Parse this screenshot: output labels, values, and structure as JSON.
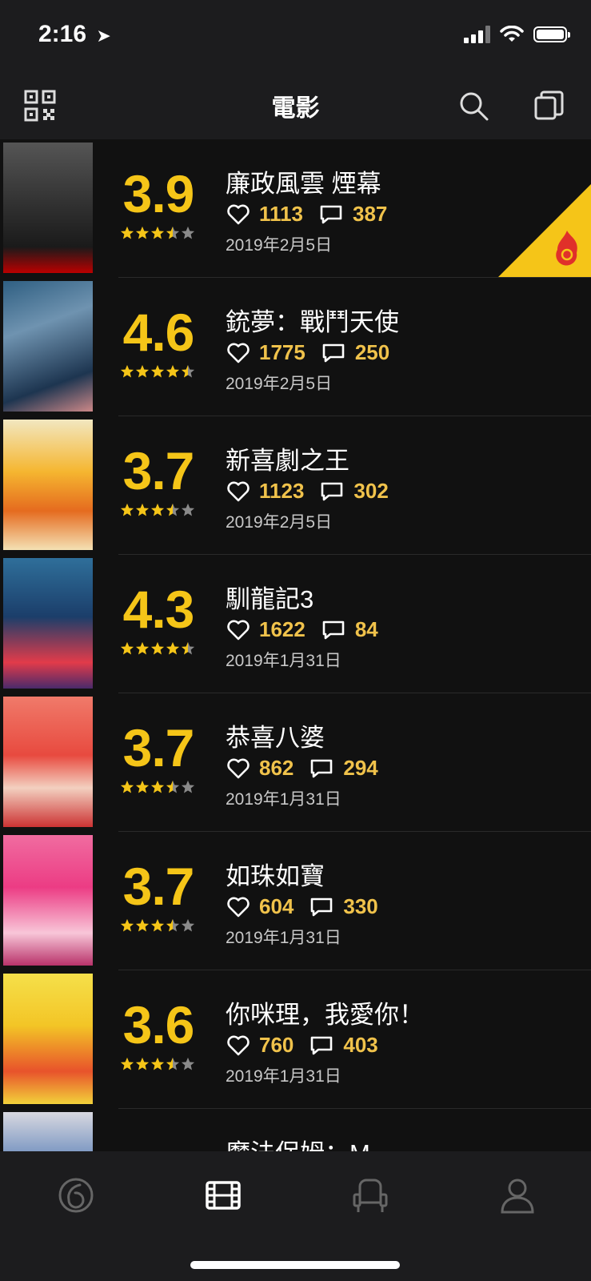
{
  "status_bar": {
    "time": "2:16"
  },
  "nav": {
    "title": "電影"
  },
  "movies": [
    {
      "title": "廉政風雲 煙幕",
      "rating": "3.9",
      "stars": 3.5,
      "likes": "1113",
      "comments": "387",
      "date": "2019年2月5日",
      "hot": true
    },
    {
      "title": "銃夢：戰鬥天使",
      "rating": "4.6",
      "stars": 4.5,
      "likes": "1775",
      "comments": "250",
      "date": "2019年2月5日",
      "hot": false
    },
    {
      "title": "新喜劇之王",
      "rating": "3.7",
      "stars": 3.5,
      "likes": "1123",
      "comments": "302",
      "date": "2019年2月5日",
      "hot": false
    },
    {
      "title": "馴龍記3",
      "rating": "4.3",
      "stars": 4.5,
      "likes": "1622",
      "comments": "84",
      "date": "2019年1月31日",
      "hot": false
    },
    {
      "title": "恭喜八婆",
      "rating": "3.7",
      "stars": 3.5,
      "likes": "862",
      "comments": "294",
      "date": "2019年1月31日",
      "hot": false
    },
    {
      "title": "如珠如寶",
      "rating": "3.7",
      "stars": 3.5,
      "likes": "604",
      "comments": "330",
      "date": "2019年1月31日",
      "hot": false
    },
    {
      "title": "你咪理，我愛你！",
      "rating": "3.6",
      "stars": 3.5,
      "likes": "760",
      "comments": "403",
      "date": "2019年1月31日",
      "hot": false
    },
    {
      "title": "魔法保姆：M",
      "rating": "",
      "stars": 0,
      "likes": "",
      "comments": "",
      "date": "",
      "hot": false
    }
  ],
  "colors": {
    "accent": "#f5c518",
    "stat": "#f0c24b",
    "background": "#111111",
    "bar": "#1c1c1e"
  },
  "tabs": [
    {
      "icon": "brand-six-icon",
      "active": false
    },
    {
      "icon": "film-icon",
      "active": true
    },
    {
      "icon": "cinema-seat-icon",
      "active": false
    },
    {
      "icon": "user-icon",
      "active": false
    }
  ]
}
